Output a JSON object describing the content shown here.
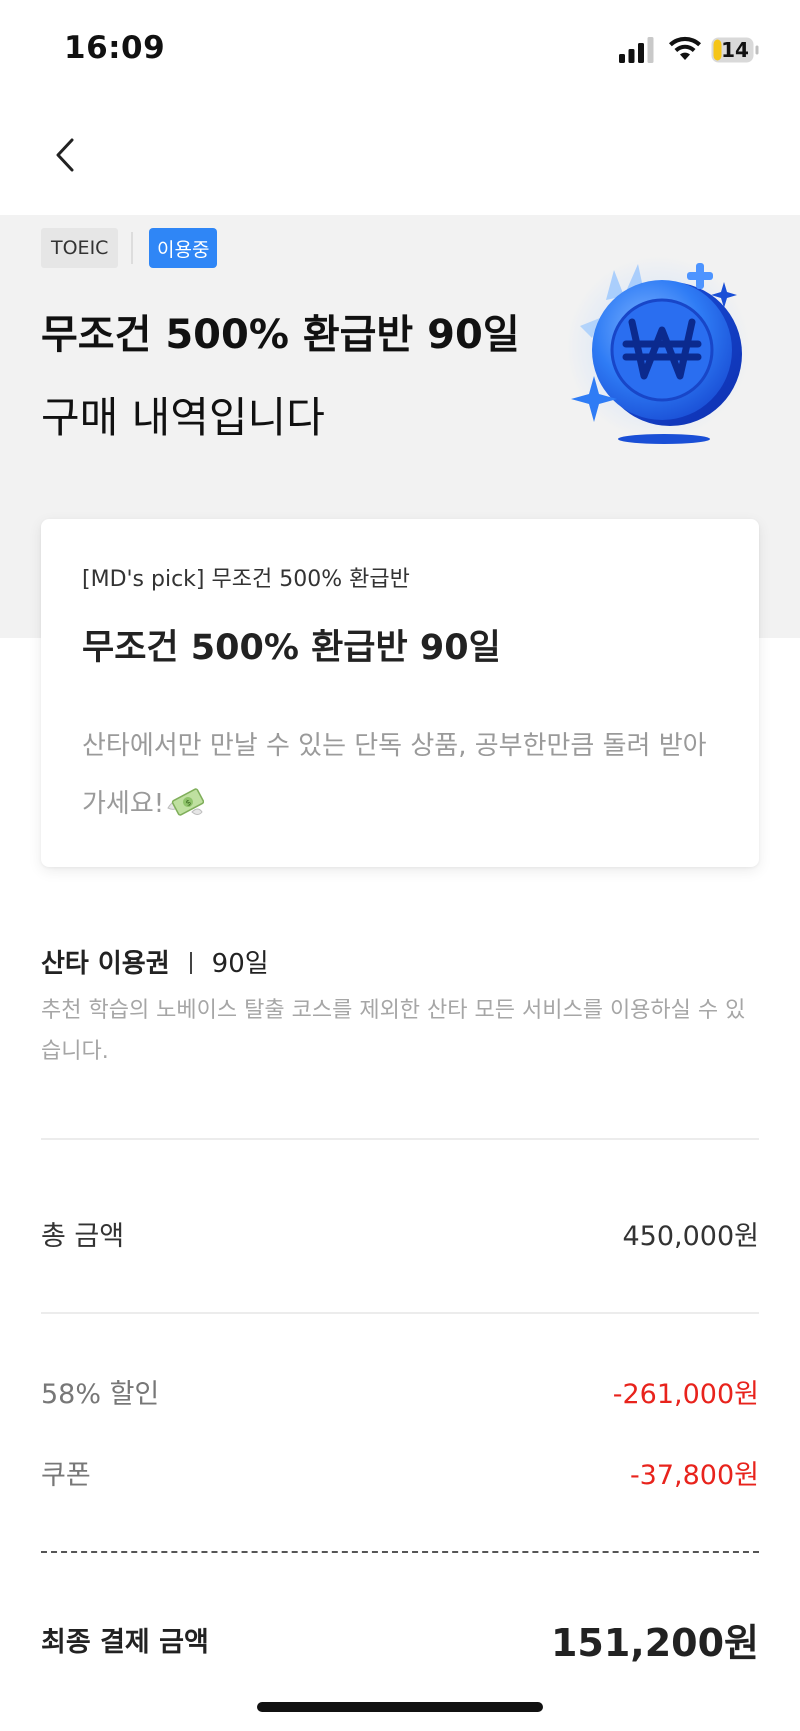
{
  "status_bar": {
    "time": "16:09",
    "battery_level": "14"
  },
  "nav": {
    "back_icon": "chevron-left-icon"
  },
  "hero": {
    "tag_exam": "TOEIC",
    "tag_status": "이용중",
    "title": "무조건 500% 환급반 90일",
    "subtitle": "구매 내역입니다",
    "illustration_icon": "won-coin-icon",
    "accent_color": "#2f86f6"
  },
  "product_card": {
    "label": "[MD's pick] 무조건 500% 환급반",
    "title": "무조건 500% 환급반 90일",
    "description": "산타에서만 만날 수 있는 단독 상품, 공부한만큼 돌려 받아 가세요!",
    "emoji_icon": "money-with-wings-icon"
  },
  "pass": {
    "name": "산타 이용권",
    "duration": "90일",
    "description": "추천 학습의 노베이스 탈출 코스를 제외한 산타 모든 서비스를 이용하실 수 있습니다."
  },
  "price": {
    "total_label": "총 금액",
    "total_value": "450,000원",
    "discount_label": "58% 할인",
    "discount_value": "-261,000원",
    "coupon_label": "쿠폰",
    "coupon_value": "-37,800원",
    "final_label": "최종 결제 금액",
    "final_value": "151,200원",
    "discount_color": "#e8231c"
  }
}
